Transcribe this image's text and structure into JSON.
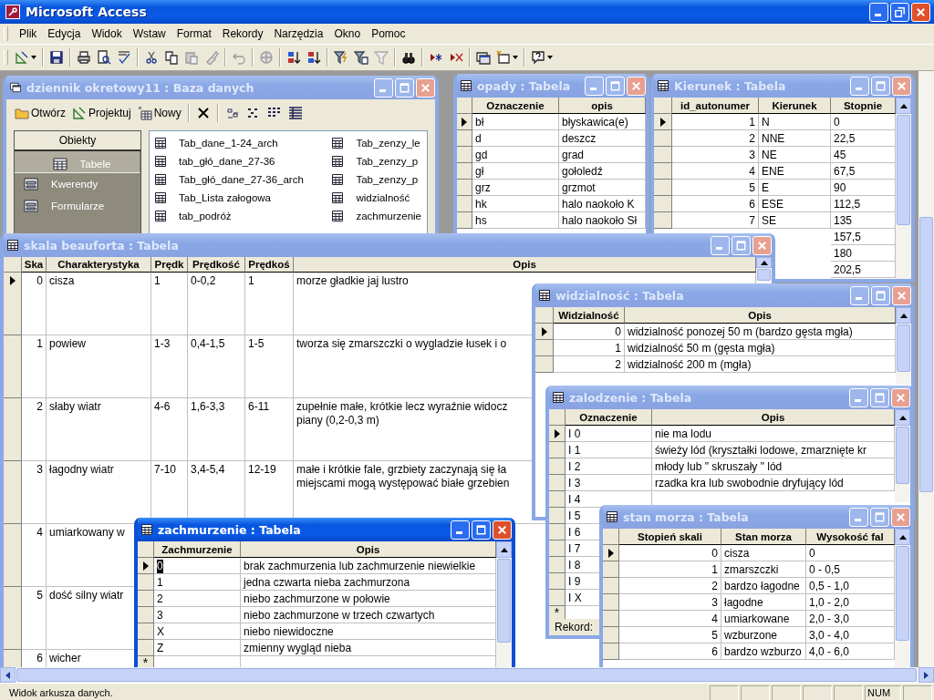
{
  "app": {
    "title": "Microsoft Access"
  },
  "menu": [
    "Plik",
    "Edycja",
    "Widok",
    "Wstaw",
    "Format",
    "Rekordy",
    "Narzędzia",
    "Okno",
    "Pomoc"
  ],
  "windows": [
    {
      "kind": "database",
      "title": "dziennik okretowy11 : Baza danych",
      "active": false,
      "toolbar": [
        "Otwórz",
        "Projektuj",
        "Nowy"
      ],
      "objects_header": "Obiekty",
      "objects": [
        {
          "label": "Tabele",
          "selected": true
        },
        {
          "label": "Kwerendy",
          "selected": false
        },
        {
          "label": "Formularze",
          "selected": false
        }
      ],
      "items": [
        [
          "Tab_dane_1-24_arch",
          "tab_głó_dane_27-36",
          "Tab_głó_dane_27-36_arch",
          "Tab_Lista załogowa",
          "tab_podróż"
        ],
        [
          "Tab_zenzy_le",
          "Tab_zenzy_p",
          "Tab_zenzy_p",
          "widzialność",
          "zachmurzenie"
        ]
      ]
    },
    {
      "kind": "table",
      "title": "opady : Tabela",
      "active": false,
      "columns": [
        {
          "label": "Oznaczenie",
          "numeric": false
        },
        {
          "label": "opis",
          "numeric": false
        }
      ],
      "rows": [
        {
          "current": true,
          "cells": [
            "bł",
            "błyskawica(e)"
          ]
        },
        {
          "current": false,
          "cells": [
            "d",
            "deszcz"
          ]
        },
        {
          "current": false,
          "cells": [
            "gd",
            "grad"
          ]
        },
        {
          "current": false,
          "cells": [
            "gł",
            "gołoledź"
          ]
        },
        {
          "current": false,
          "cells": [
            "grz",
            "grzmot"
          ]
        },
        {
          "current": false,
          "cells": [
            "hk",
            "halo naokoło K"
          ]
        },
        {
          "current": false,
          "cells": [
            "hs",
            "halo naokoło Sł"
          ]
        }
      ]
    },
    {
      "kind": "table",
      "title": "Kierunek : Tabela",
      "active": false,
      "columns": [
        {
          "label": "id_autonumer",
          "numeric": true
        },
        {
          "label": "Kierunek",
          "numeric": false
        },
        {
          "label": "Stopnie",
          "numeric": false
        }
      ],
      "rows": [
        {
          "current": true,
          "cells": [
            "1",
            "N",
            "0"
          ]
        },
        {
          "current": false,
          "cells": [
            "2",
            "NNE",
            "22,5"
          ]
        },
        {
          "current": false,
          "cells": [
            "3",
            "NE",
            "45"
          ]
        },
        {
          "current": false,
          "cells": [
            "4",
            "ENE",
            "67,5"
          ]
        },
        {
          "current": false,
          "cells": [
            "5",
            "E",
            "90"
          ]
        },
        {
          "current": false,
          "cells": [
            "6",
            "ESE",
            "112,5"
          ]
        },
        {
          "current": false,
          "cells": [
            "7",
            "SE",
            "135"
          ]
        },
        {
          "cells": [
            null,
            null,
            "157,5"
          ]
        },
        {
          "cells": [
            null,
            null,
            "180"
          ]
        },
        {
          "cells": [
            null,
            null,
            "202,5"
          ]
        }
      ]
    },
    {
      "kind": "table",
      "title": "skala beauforta : Tabela",
      "active": false,
      "columns": [
        {
          "label": "Ska",
          "numeric": true
        },
        {
          "label": "Charakterystyka",
          "numeric": false
        },
        {
          "label": "Prędk",
          "numeric": false
        },
        {
          "label": "Prędkość",
          "numeric": false
        },
        {
          "label": "Prędkoś",
          "numeric": false
        },
        {
          "label": "Opis",
          "numeric": false
        }
      ],
      "rows": [
        {
          "current": true,
          "cells": [
            "0",
            "cisza",
            "1",
            "0-0,2",
            "1",
            "morze gładkie jaj lustro"
          ]
        },
        {
          "current": false,
          "cells": [
            "1",
            "powiew",
            "1-3",
            "0,4-1,5",
            "1-5",
            "tworza się zmarszczki o wygladzie łusek i o"
          ]
        },
        {
          "current": false,
          "cells": [
            "2",
            "słaby wiatr",
            "4-6",
            "1,6-3,3",
            "6-11",
            "zupełnie małe, krótkie lecz wyraźnie widocz\npiany (0,2-0,3 m)"
          ]
        },
        {
          "current": false,
          "cells": [
            "3",
            "łagodny wiatr",
            "7-10",
            "3,4-5,4",
            "12-19",
            "małe i krótkie fale, grzbiety zaczynają się ła\nmiejscami mogą występować białe grzebien"
          ]
        },
        {
          "current": false,
          "cells": [
            "4",
            "umiarkowany w",
            null,
            null,
            null,
            null
          ]
        },
        {
          "current": false,
          "cells": [
            "5",
            "dość silny wiatr",
            null,
            null,
            null,
            null
          ]
        },
        {
          "current": false,
          "cells": [
            "6",
            "wicher",
            null,
            null,
            null,
            null
          ]
        }
      ]
    },
    {
      "kind": "table",
      "title": "widzialność : Tabela",
      "active": false,
      "columns": [
        {
          "label": "Widzialność",
          "numeric": true
        },
        {
          "label": "Opis",
          "numeric": false
        }
      ],
      "rows": [
        {
          "current": true,
          "cells": [
            "0",
            "widzialność ponozej 50 m (bardzo gęsta mgła)"
          ]
        },
        {
          "current": false,
          "cells": [
            "1",
            "widzialność 50 m (gęsta mgła)"
          ]
        },
        {
          "current": false,
          "cells": [
            "2",
            "widzialność 200 m (mgła)"
          ]
        }
      ]
    },
    {
      "kind": "table",
      "title": "zalodzenie : Tabela",
      "active": false,
      "columns": [
        {
          "label": "Oznaczenie",
          "numeric": false
        },
        {
          "label": "Opis",
          "numeric": false
        }
      ],
      "rows": [
        {
          "current": true,
          "cells": [
            "I 0",
            "nie ma lodu"
          ]
        },
        {
          "current": false,
          "cells": [
            "I 1",
            "świeży lód (kryształki lodowe, zmarznięte kr"
          ]
        },
        {
          "current": false,
          "cells": [
            "I 2",
            "młody lub \" skruszały \" lód"
          ]
        },
        {
          "current": false,
          "cells": [
            "I 3",
            "rzadka kra lub swobodnie dryfujący lód"
          ]
        },
        {
          "current": false,
          "cells": [
            "I 4",
            null
          ]
        },
        {
          "current": false,
          "cells": [
            "I 5",
            null
          ]
        },
        {
          "current": false,
          "cells": [
            "I 6",
            null
          ]
        },
        {
          "current": false,
          "cells": [
            "I 7",
            null
          ]
        },
        {
          "current": false,
          "cells": [
            "I 8",
            null
          ]
        },
        {
          "current": false,
          "cells": [
            "I 9",
            null
          ]
        },
        {
          "current": false,
          "cells": [
            "I X",
            null
          ]
        }
      ],
      "new_row": "*",
      "record_label": "Rekord:"
    },
    {
      "kind": "table",
      "title": "stan morza : Tabela",
      "active": false,
      "columns": [
        {
          "label": "Stopień skali",
          "numeric": true
        },
        {
          "label": "Stan morza",
          "numeric": false
        },
        {
          "label": "Wysokość fal",
          "numeric": false
        }
      ],
      "rows": [
        {
          "current": true,
          "cells": [
            "0",
            "cisza",
            "0"
          ]
        },
        {
          "current": false,
          "cells": [
            "1",
            "zmarszczki",
            "0 - 0,5"
          ]
        },
        {
          "current": false,
          "cells": [
            "2",
            "bardzo łagodne",
            "0,5 - 1,0"
          ]
        },
        {
          "current": false,
          "cells": [
            "3",
            "łagodne",
            "1,0 - 2,0"
          ]
        },
        {
          "current": false,
          "cells": [
            "4",
            "umiarkowane",
            "2,0 - 3,0"
          ]
        },
        {
          "current": false,
          "cells": [
            "5",
            "wzburzone",
            "3,0 - 4,0"
          ]
        },
        {
          "current": false,
          "cells": [
            "6",
            "bardzo wzburzo",
            "4,0 - 6,0"
          ]
        }
      ]
    },
    {
      "kind": "table",
      "title": "zachmurzenie : Tabela",
      "active": true,
      "columns": [
        {
          "label": "Zachmurzenie",
          "numeric": false
        },
        {
          "label": "Opis",
          "numeric": false
        }
      ],
      "rows": [
        {
          "current": true,
          "cells": [
            "0",
            "brak zachmurzenia lub zachmurzenie niewielkie"
          ]
        },
        {
          "current": false,
          "cells": [
            "1",
            "jedna czwarta nieba zachmurzona"
          ]
        },
        {
          "current": false,
          "cells": [
            "2",
            "niebo zachmurzone w połowie"
          ]
        },
        {
          "current": false,
          "cells": [
            "3",
            "niebo zachmurzone w trzech czwartych"
          ]
        },
        {
          "current": false,
          "cells": [
            "X",
            "niebo niewidoczne"
          ]
        },
        {
          "current": false,
          "cells": [
            "Z",
            "zmienny wygląd nieba"
          ]
        }
      ],
      "new_row": "*"
    }
  ],
  "status": {
    "text": "Widok arkusza danych.",
    "indicator": "NUM"
  }
}
